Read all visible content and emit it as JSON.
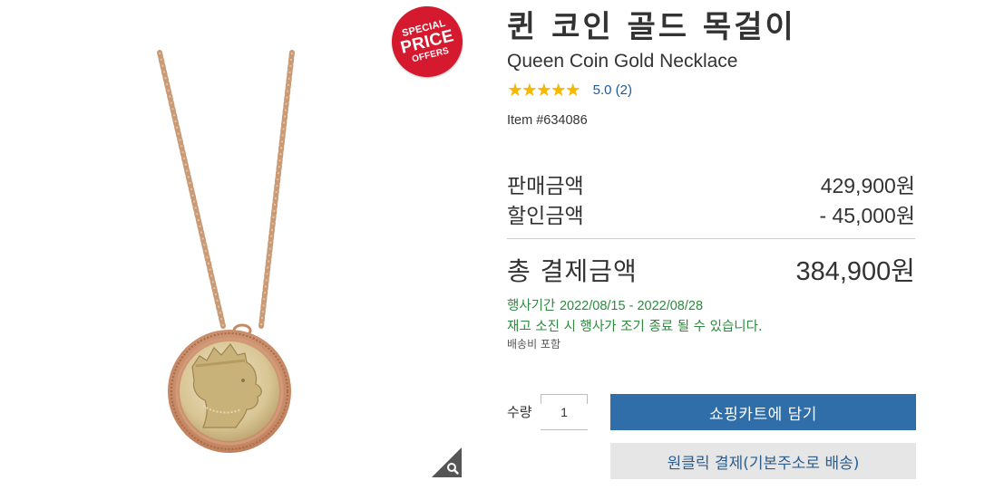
{
  "product": {
    "title_ko": "퀸 코인 골드 목걸이",
    "title_en": "Queen Coin Gold Necklace",
    "stars": "★★★★★",
    "rating_value": 5.0,
    "rating_text": "5.0  (2)",
    "item_number": "Item #634086"
  },
  "badge": {
    "line1": "SPECIAL",
    "line2": "PRICE",
    "line3": "OFFERS"
  },
  "prices": {
    "sale_label": "판매금액",
    "sale_value": "429,900원",
    "discount_label": "할인금액",
    "discount_value": "- 45,000원",
    "total_label": "총 결제금액",
    "total_value": "384,900원"
  },
  "event": {
    "period_label": "행사기간",
    "period_dates": "2022/08/15 - 2022/08/28",
    "note": "재고 소진 시 행사가 조기 종료 될 수 있습니다.",
    "shipping": "배송비 포함"
  },
  "purchase": {
    "qty_label": "수량",
    "qty_value": "1",
    "cart_button": "쇼핑카트에 담기",
    "oneclick_button": "원클릭 결제(기본주소로 배송)"
  },
  "colors": {
    "badge_red": "#d5192e",
    "star_gold": "#f5b800",
    "link_blue": "#1a5b9a",
    "event_green": "#2d8a3e",
    "cart_button_blue": "#2f6ea8",
    "oneclick_bg": "#e6e6e6"
  },
  "icons": {
    "zoom": "magnifier-icon",
    "stars": "star-icon"
  }
}
